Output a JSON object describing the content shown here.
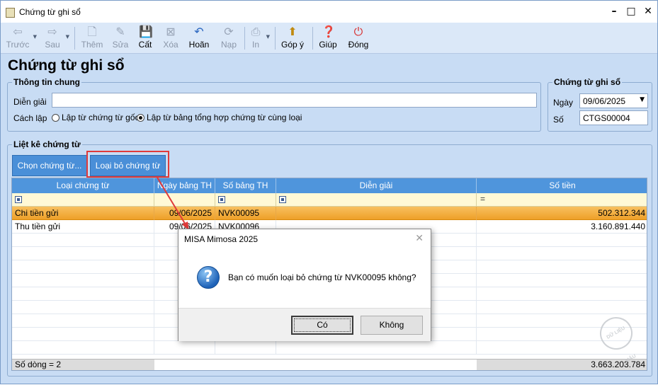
{
  "window": {
    "title": "Chứng từ ghi sổ"
  },
  "toolbar": {
    "items": [
      {
        "label": "Trước",
        "icon": "arrow-left-icon"
      },
      {
        "label": "Sau",
        "icon": "arrow-right-icon"
      },
      {
        "label": "Thêm",
        "icon": "add-doc-icon"
      },
      {
        "label": "Sửa",
        "icon": "edit-doc-icon"
      },
      {
        "label": "Cất",
        "icon": "save-icon"
      },
      {
        "label": "Xóa",
        "icon": "delete-doc-icon"
      },
      {
        "label": "Hoãn",
        "icon": "undo-icon"
      },
      {
        "label": "Nạp",
        "icon": "refresh-icon"
      },
      {
        "label": "In",
        "icon": "printer-icon"
      },
      {
        "label": "Góp ý",
        "icon": "feedback-icon"
      },
      {
        "label": "Giúp",
        "icon": "help-icon"
      },
      {
        "label": "Đóng",
        "icon": "power-icon"
      }
    ]
  },
  "page": {
    "title": "Chứng từ ghi sổ"
  },
  "general": {
    "group_label": "Thông tin chung",
    "description_label": "Diễn giải",
    "description_value": "",
    "method_label": "Cách lập",
    "option1": "Lập từ chứng từ gốc",
    "option2": "Lập từ bảng tổng hợp chứng từ cùng loại",
    "selected_option": 2
  },
  "voucher": {
    "group_label": "Chứng từ ghi sổ",
    "date_label": "Ngày",
    "date_value": "09/06/2025",
    "number_label": "Số",
    "number_value": "CTGS00004"
  },
  "list": {
    "group_label": "Liệt kê chứng từ",
    "choose_button": "Chọn chứng từ...",
    "remove_button": "Loại bỏ chứng từ",
    "columns": [
      "Loại chứng từ",
      "Ngày bảng TH",
      "Số bảng TH",
      "Diễn giải",
      "Số tiền"
    ],
    "rows": [
      {
        "type": "Chi tiền gửi",
        "date": "09/06/2025",
        "number": "NVK00095",
        "desc": "",
        "amount": "502.312.344"
      },
      {
        "type": "Thu tiền gửi",
        "date": "09/06/2025",
        "number": "NVK00096",
        "desc": "",
        "amount": "3.160.891.440"
      }
    ],
    "footer_count": "Số dòng = 2",
    "footer_total": "3.663.203.784"
  },
  "dialog": {
    "title": "MISA Mimosa 2025",
    "message": "Bạn có muốn loại bỏ chứng từ NVK00095 không?",
    "yes": "Có",
    "no": "Không"
  },
  "colors": {
    "accent": "#4a8fd8",
    "highlight": "#e03a3a",
    "selected_row": "#eea028"
  }
}
